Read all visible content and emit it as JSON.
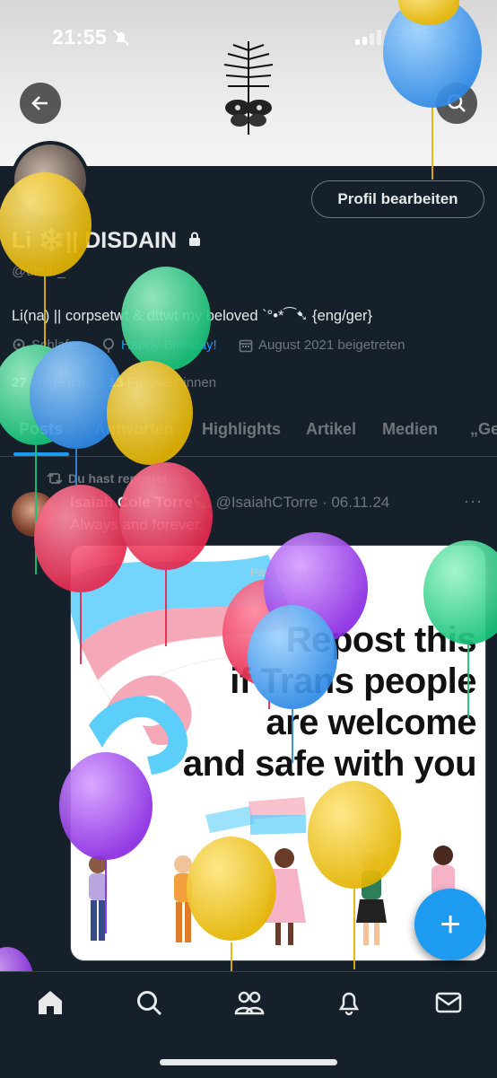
{
  "status_bar": {
    "time": "21:55"
  },
  "profile": {
    "name": "Li ❄️|| DISDAIN",
    "handle": "@tibub_",
    "bio": "Li(na) || corpsetwt & dttwt my beloved `°•*⁀➷ {eng/ger}",
    "location": "Schlafer",
    "birthday": "Happy Birthday!",
    "joined": "August 2021 beigetreten",
    "following_count": "27",
    "following_label": "Folge ich",
    "followers_count": "13",
    "followers_label": "Follower*innen",
    "edit_button": "Profil bearbeiten"
  },
  "tabs": [
    {
      "label": "Posts"
    },
    {
      "label": "Antworten"
    },
    {
      "label": "Highlights"
    },
    {
      "label": "Artikel"
    },
    {
      "label": "Medien"
    },
    {
      "label": "„Ge"
    }
  ],
  "post": {
    "reposted_label": "Du hast repostet",
    "author_name": "Isaiah Cole Torre🦕",
    "author_handle": "@IsaiahCTorre",
    "date": "· 06.11.24",
    "more": "···",
    "text": "Always and forever.",
    "image": {
      "watermark": "ParadiseRain.com",
      "lines": [
        "Repost this",
        "if Trans people",
        "are welcome",
        "and safe with you"
      ]
    }
  },
  "fab": {
    "label": "+"
  },
  "colors": {
    "accent": "#1d9bf0",
    "background": "#15202b",
    "muted": "#71767b"
  },
  "bottom_nav": [
    {
      "icon": "home-icon"
    },
    {
      "icon": "search-icon"
    },
    {
      "icon": "communities-icon"
    },
    {
      "icon": "notifications-icon"
    },
    {
      "icon": "messages-icon"
    }
  ]
}
